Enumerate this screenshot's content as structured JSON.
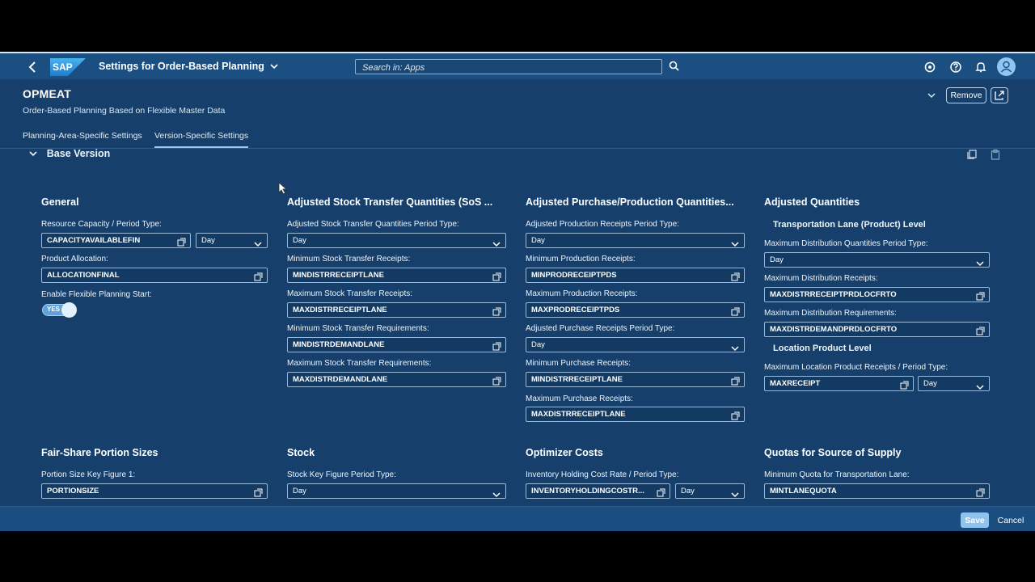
{
  "shell": {
    "logo_text": "SAP",
    "app_title": "Settings for Order-Based Planning",
    "search_placeholder": "Search in: Apps",
    "icons": [
      "back-icon",
      "search-icon",
      "help-icon",
      "question-icon",
      "bell-icon",
      "user-icon"
    ]
  },
  "header": {
    "title": "OPMEAT",
    "subtitle": "Order-Based Planning Based on Flexible Master Data",
    "remove_label": "Remove"
  },
  "tabs": [
    {
      "label": "Planning-Area-Specific Settings",
      "active": false
    },
    {
      "label": "Version-Specific Settings",
      "active": true
    }
  ],
  "section": {
    "title": "Base Version"
  },
  "general": {
    "title": "General",
    "resource_capacity_label": "Resource Capacity / Period Type:",
    "resource_capacity_value": "CAPACITYAVAILABLEFIN",
    "resource_capacity_period": "Day",
    "product_allocation_label": "Product Allocation:",
    "product_allocation_value": "ALLOCATIONFINAL",
    "flexible_start_label": "Enable Flexible Planning Start:",
    "flexible_start_toggle": "YES"
  },
  "sto": {
    "title": "Adjusted Stock Transfer Quantities (SoS ...",
    "period_label": "Adjusted Stock Transfer Quantities Period Type:",
    "period_value": "Day",
    "min_receipts_label": "Minimum Stock Transfer Receipts:",
    "min_receipts_value": "MINDISTRRECEIPTLANE",
    "max_receipts_label": "Maximum Stock Transfer Receipts:",
    "max_receipts_value": "MAXDISTRRECEIPTLANE",
    "min_req_label": "Minimum Stock Transfer Requirements:",
    "min_req_value": "MINDISTRDEMANDLANE",
    "max_req_label": "Maximum Stock Transfer Requirements:",
    "max_req_value": "MAXDISTRDEMANDLANE"
  },
  "purch": {
    "title": "Adjusted Purchase/Production Quantities...",
    "prod_period_label": "Adjusted Production Receipts Period Type:",
    "prod_period_value": "Day",
    "min_prod_label": "Minimum Production Receipts:",
    "min_prod_value": "MINPRODRECEIPTPDS",
    "max_prod_label": "Maximum Production Receipts:",
    "max_prod_value": "MAXPRODRECEIPTPDS",
    "purch_period_label": "Adjusted Purchase Receipts Period Type:",
    "purch_period_value": "Day",
    "min_purch_label": "Minimum Purchase Receipts:",
    "min_purch_value": "MINDISTRRECEIPTLANE",
    "max_purch_label": "Maximum Purchase Receipts:",
    "max_purch_value": "MAXDISTRRECEIPTLANE"
  },
  "adjusted": {
    "title": "Adjusted Quantities",
    "lane_level": "Transportation Lane (Product) Level",
    "dist_period_label": "Maximum Distribution Quantities Period Type:",
    "dist_period_value": "Day",
    "dist_receipts_label": "Maximum Distribution Receipts:",
    "dist_receipts_value": "MAXDISTRRECEIPTPRDLOCFRTO",
    "dist_req_label": "Maximum Distribution Requirements:",
    "dist_req_value": "MAXDISTRDEMANDPRDLOCFRTO",
    "loc_level": "Location Product Level",
    "loc_receipts_label": "Maximum Location Product Receipts / Period Type:",
    "loc_receipts_value": "MAXRECEIPT",
    "loc_receipts_period": "Day"
  },
  "fairshare": {
    "title": "Fair-Share Portion Sizes",
    "key1_label": "Portion Size Key Figure 1:",
    "key1_value": "PORTIONSIZE"
  },
  "stock": {
    "title": "Stock",
    "period_label": "Stock Key Figure Period Type:",
    "period_value": "Day"
  },
  "optimizer": {
    "title": "Optimizer Costs",
    "holding_label": "Inventory Holding Cost Rate / Period Type:",
    "holding_value": "INVENTORYHOLDINGCOSTR...",
    "holding_period": "Day"
  },
  "quotas": {
    "title": "Quotas for Source of Supply",
    "min_lane_label": "Minimum Quota for Transportation Lane:",
    "min_lane_value": "MINTLANEQUOTA"
  },
  "footer": {
    "save_label": "Save",
    "cancel_label": "Cancel"
  },
  "colors": {
    "shell_bg": "#1b4f82",
    "page_bg": "#16406b",
    "field_border": "#9cbbd9",
    "toggle_on": "#5fa2dd",
    "save_bg": "#8ec3f0"
  }
}
